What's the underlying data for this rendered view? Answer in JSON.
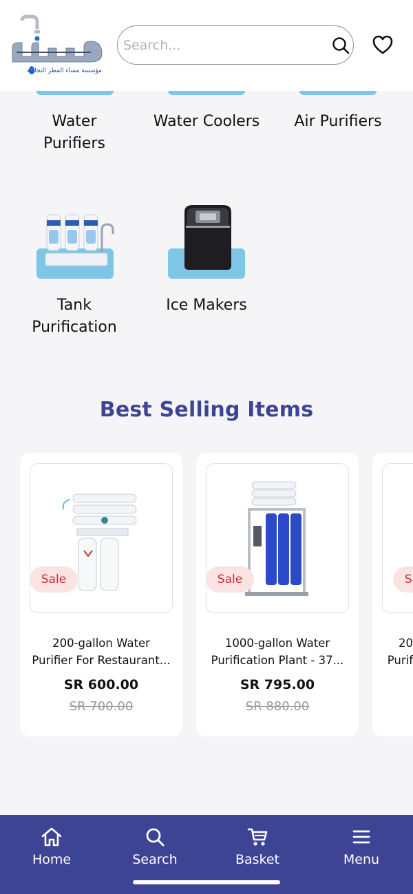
{
  "header": {
    "logo_text": "مساء",
    "logo_subtitle": "مؤسسة مساء المطر التجارية",
    "search_placeholder": "Search..."
  },
  "categories": [
    {
      "label_lines": [
        "Water",
        "Purifiers"
      ],
      "icon": "water-purifier-image"
    },
    {
      "label_lines": [
        "Water Coolers"
      ],
      "icon": "water-cooler-image"
    },
    {
      "label_lines": [
        "Air Purifiers"
      ],
      "icon": "air-purifier-image"
    },
    {
      "label_lines": [
        "Tank",
        "Purification"
      ],
      "icon": "tank-purification-image"
    },
    {
      "label_lines": [
        "Ice Makers"
      ],
      "icon": "ice-maker-image"
    }
  ],
  "best_selling": {
    "title": "Best Selling Items",
    "products": [
      {
        "badge": "Sale",
        "name_lines": [
          "200-gallon Water",
          "Purifier For Restaurant..."
        ],
        "price": "SR 600.00",
        "old_price": "SR 700.00"
      },
      {
        "badge": "Sale",
        "name_lines": [
          "1000-gallon Water",
          "Purification Plant - 37..."
        ],
        "price": "SR 795.00",
        "old_price": "SR 880.00"
      },
      {
        "badge": "Sale",
        "name_lines": [
          "20",
          "Purif"
        ],
        "price": "",
        "old_price": ""
      }
    ]
  },
  "bottom_nav": [
    {
      "label": "Home",
      "icon": "home-icon"
    },
    {
      "label": "Search",
      "icon": "search-icon"
    },
    {
      "label": "Basket",
      "icon": "basket-icon"
    },
    {
      "label": "Menu",
      "icon": "menu-icon"
    }
  ],
  "colors": {
    "brand": "#3e4494",
    "tile": "#7fc6e6",
    "sale_bg": "#fbe3e4",
    "sale_text": "#d6262c"
  }
}
